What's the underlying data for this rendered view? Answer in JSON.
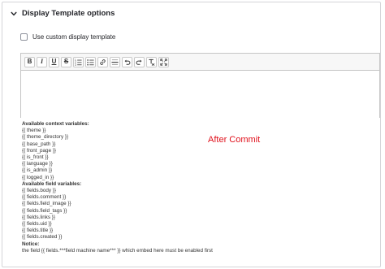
{
  "details": {
    "title": "Display Template options",
    "chevron_icon": "chevron-down-icon"
  },
  "checkbox": {
    "label": "Use custom display template",
    "checked": false
  },
  "toolbar": {
    "buttons": [
      {
        "name": "bold-button",
        "label": "B",
        "icon": "bold-icon"
      },
      {
        "name": "italic-button",
        "label": "I",
        "icon": "italic-icon"
      },
      {
        "name": "underline-button",
        "label": "U",
        "icon": "underline-icon"
      },
      {
        "name": "strikethrough-button",
        "label": "S",
        "icon": "strikethrough-icon"
      },
      {
        "name": "numbered-list-button",
        "icon": "numbered-list-icon"
      },
      {
        "name": "bulleted-list-button",
        "icon": "bulleted-list-icon"
      },
      {
        "name": "link-button",
        "icon": "link-icon"
      },
      {
        "name": "horizontal-line-button",
        "icon": "horizontal-line-icon"
      },
      {
        "name": "undo-button",
        "icon": "undo-icon"
      },
      {
        "name": "redo-button",
        "icon": "redo-icon"
      },
      {
        "name": "remove-format-button",
        "icon": "remove-format-icon"
      },
      {
        "name": "fullscreen-button",
        "icon": "fullscreen-icon"
      }
    ]
  },
  "help": {
    "context_heading": "Available context variables:",
    "context_vars": [
      "{{ theme }}",
      "{{ theme_directory }}",
      "{{ base_path }}",
      "{{ front_page }}",
      "{{ is_front }}",
      "{{ language }}",
      "{{ is_admin }}",
      "{{ logged_in }}"
    ],
    "field_heading": "Available field variables:",
    "field_vars": [
      "{{ fields.body }}",
      "{{ fields.comment }}",
      "{{ fields.field_image }}",
      "{{ fields.field_tags }}",
      "{{ fields.links }}",
      "{{ fields.uid }}",
      "{{ fields.title }}",
      "{{ fields.created }}"
    ],
    "notice_heading": "Notice:",
    "notice_text": "the field {{ fields.***field machine name*** }} which embed here must be enabled first"
  },
  "annotation": {
    "text": "After Commit",
    "color": "#e0101b"
  }
}
